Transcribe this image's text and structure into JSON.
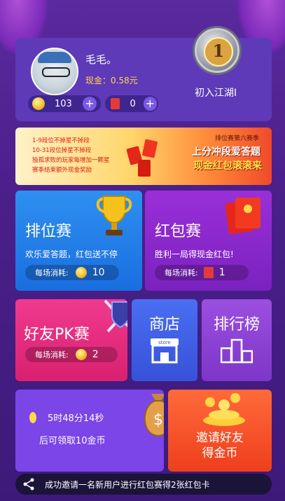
{
  "profile": {
    "username": "毛毛。",
    "cash_label": "现金：0.58元",
    "coins": "103",
    "cards": "0",
    "plus": "+"
  },
  "rank": {
    "level": "1",
    "title": "初入江湖I"
  },
  "banner": {
    "line1": "1-9段位不掉星不掉段",
    "line2": "10-31段位掉星不掉段",
    "line3": "独孤求败的玩家每增加一颗星",
    "line4": "赛季结束额外现金奖励",
    "season": "排位赛第六赛季",
    "slogan1": "上分冲段爱答题",
    "slogan2": "现金红包滚滚来"
  },
  "tiles": {
    "qualifying": {
      "title": "排位赛",
      "subtitle": "欢乐爱答题，红包送不停",
      "cost_label": "每场消耗:",
      "cost": "10"
    },
    "redpacket": {
      "title": "红包赛",
      "subtitle": "胜利一局得现金红包!",
      "cost_label": "每场消耗:",
      "cost": "1"
    },
    "friend_pk": {
      "title": "好友PK赛",
      "cost_label": "每场消耗:",
      "cost": "2"
    },
    "shop": {
      "title": "商店",
      "store": "store"
    },
    "leaderboard": {
      "title": "排行榜"
    },
    "timer": {
      "countdown": "5时48分14秒",
      "subtitle": "后可领取10金币"
    },
    "invite": {
      "line1": "邀请好友",
      "line2": "得金币"
    }
  },
  "marquee": {
    "message": "成功邀请一名新用户进行红包赛得2张红包卡"
  },
  "colors": {
    "background": "#4a1f8a",
    "accent_gold": "#ffd84a",
    "qualifying": "#2e90f0",
    "redpacket": "#9a2fd8",
    "friend": "#f03a8e",
    "shop": "#4a6ef2",
    "leaderboard": "#9b4fe0",
    "timer": "#7b45e8",
    "invite": "#ff6a3a"
  }
}
